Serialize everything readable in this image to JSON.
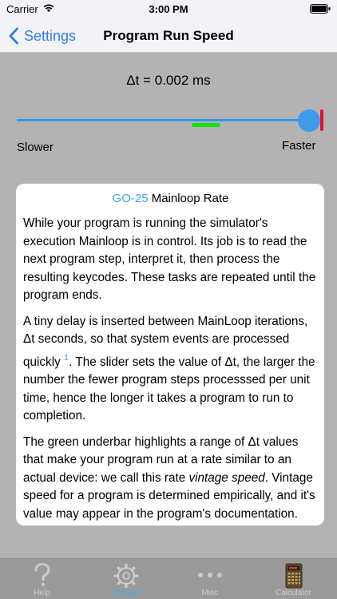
{
  "status_bar": {
    "carrier": "Carrier",
    "time": "3:00 PM"
  },
  "nav": {
    "back_label": "Settings",
    "title": "Program Run Speed"
  },
  "speed": {
    "readout": "Δt = 0.002 ms",
    "slider_position": 0.97,
    "vintage_range": [
      0.6,
      0.7
    ],
    "slower_label": "Slower",
    "faster_label": "Faster"
  },
  "card": {
    "title_code": "GO-25",
    "title_rest": " Mainloop Rate",
    "para1": "While your program is running the simulator's execution Mainloop is in control. Its job is to read the next program step, interpret it, then process the resulting keycodes. These tasks are repeated until the program ends.",
    "para2_a": "A tiny delay is inserted between MainLoop iterations, Δt seconds, so that system events are processed quickly ",
    "para2_footnote": "1",
    "para2_b": ". The slider sets the value of Δt, the larger the number the fewer program steps processsed per unit time, hence the longer it takes a program to run to completion.",
    "para3_a": "The green underbar highlights a range of Δt values that make your program run at a rate similar to an actual device: we call this rate ",
    "para3_em": "vintage speed",
    "para3_b": ". Vintage speed for a program is determined empirically, and it's value may appear in the program's documentation."
  },
  "tabs": [
    {
      "label": "Help",
      "icon": "question-mark-icon",
      "active": false
    },
    {
      "label": "Settings",
      "icon": "gear-icon",
      "active": true
    },
    {
      "label": "Misc",
      "icon": "ellipsis-icon",
      "active": false
    },
    {
      "label": "Calculator",
      "icon": "calculator-icon",
      "active": false
    }
  ],
  "colors": {
    "accent": "#2f7bf5",
    "slider": "#2f98f0",
    "vintage_bar": "#15e10f",
    "max_marker": "#e0102a",
    "title_code": "#3aa9e8"
  }
}
